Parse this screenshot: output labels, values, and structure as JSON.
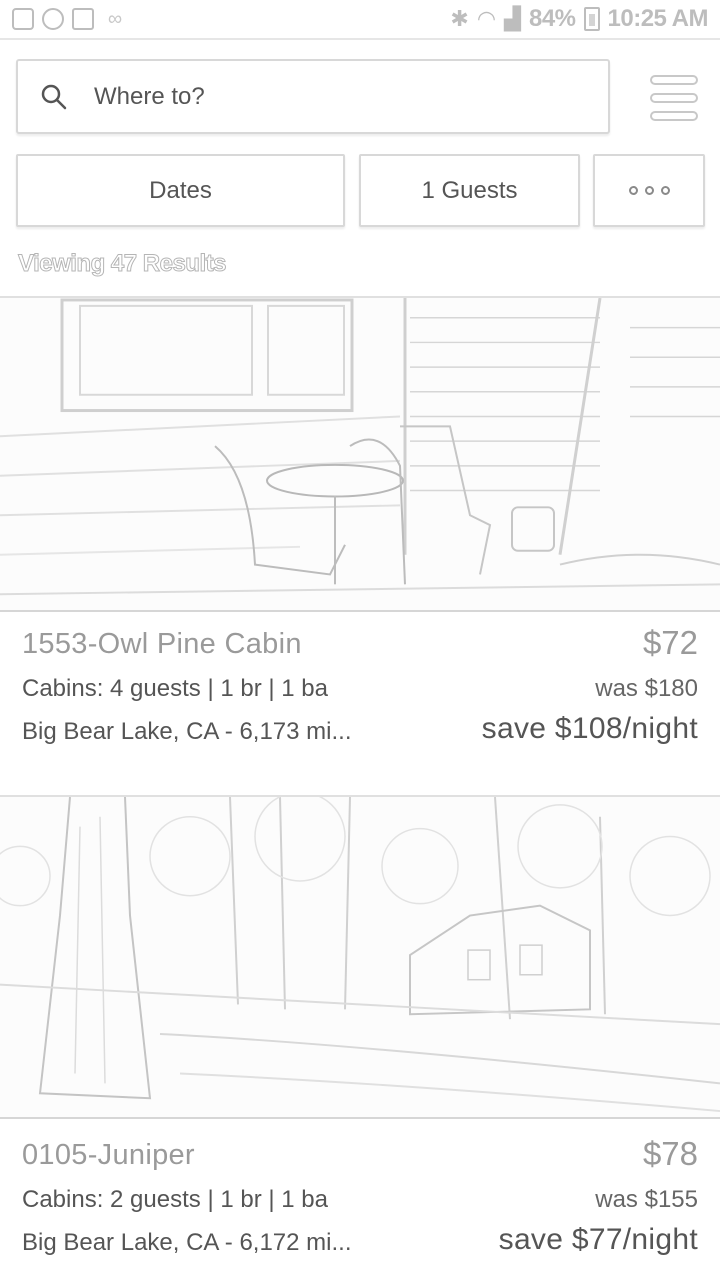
{
  "status_bar": {
    "left_icons": [
      "gallery-icon",
      "settings-icon",
      "check-icon",
      "voicemail-icon"
    ],
    "battery_text": "84%",
    "time": "10:25 AM"
  },
  "search": {
    "placeholder": "Where to?"
  },
  "filters": {
    "dates_label": "Dates",
    "guests_label": "1 Guests"
  },
  "results": {
    "text": "Viewing 47 Results"
  },
  "listings": [
    {
      "name": "1553-Owl Pine Cabin",
      "price": "$72",
      "details": "Cabins: 4 guests | 1 br | 1 ba",
      "was": "was $180",
      "location": "Big Bear Lake, CA - 6,173 mi...",
      "save": "save $108/night"
    },
    {
      "name": "0105-Juniper",
      "price": "$78",
      "details": "Cabins: 2 guests | 1 br | 1 ba",
      "was": "was $155",
      "location": "Big Bear Lake, CA - 6,172 mi...",
      "save": "save $77/night"
    }
  ]
}
